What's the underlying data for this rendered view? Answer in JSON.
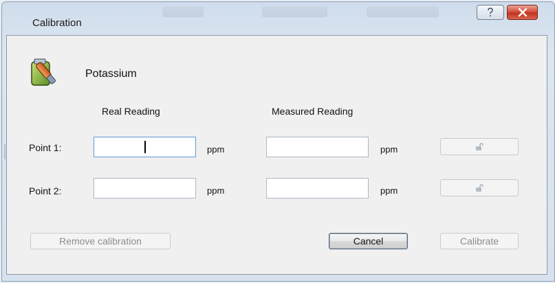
{
  "window": {
    "title": "Calibration"
  },
  "titlebar_buttons": {
    "help_icon": "question-mark",
    "close_icon": "x"
  },
  "element": {
    "name": "Potassium",
    "icon": "potassium-sensor-icon"
  },
  "columns": {
    "real": "Real Reading",
    "measured": "Measured Reading"
  },
  "points": [
    {
      "label": "Point 1:",
      "real_value": "",
      "measured_value": "",
      "unit_real": "ppm",
      "unit_measured": "ppm",
      "lock_icon": "unlocked-padlock"
    },
    {
      "label": "Point 2:",
      "real_value": "",
      "measured_value": "",
      "unit_real": "ppm",
      "unit_measured": "ppm",
      "lock_icon": "unlocked-padlock"
    }
  ],
  "buttons": {
    "remove": "Remove calibration",
    "cancel": "Cancel",
    "calibrate": "Calibrate"
  },
  "colors": {
    "close_button": "#c2331f",
    "focus_border": "#5b98d6",
    "disabled_text": "#8d8d8d"
  }
}
